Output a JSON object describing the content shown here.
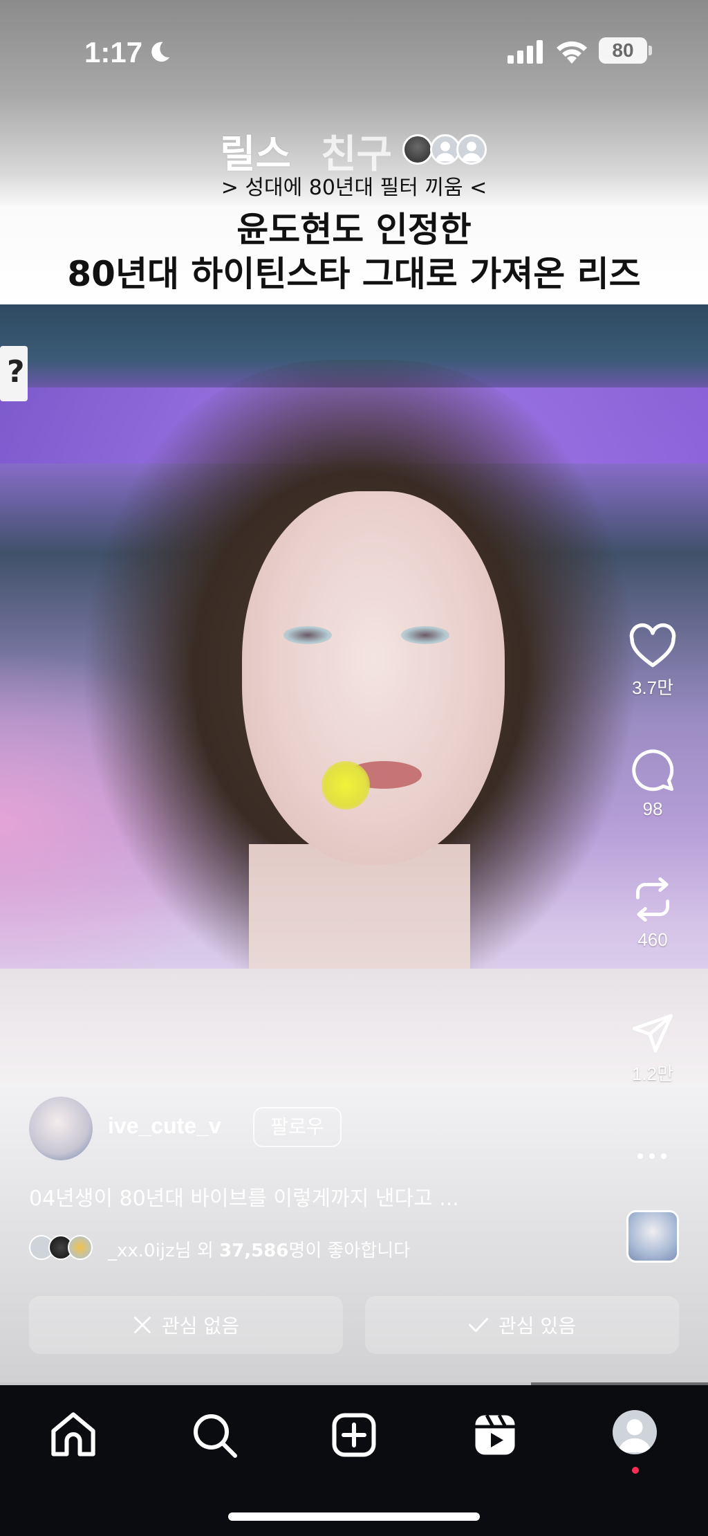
{
  "status_bar": {
    "time": "1:17",
    "battery": "80"
  },
  "header": {
    "tab_reels": "릴스",
    "tab_friends": "친구",
    "video_subtitle_small": "> 성대에 80년대 필터 끼움 <",
    "headline_line1": "윤도현도 인정한",
    "headline_line2": "80년대 하이틴스타 그대로 가져온 리즈"
  },
  "video": {
    "sign_text": "?"
  },
  "actions": {
    "like_count": "3.7만",
    "comment_count": "98",
    "repost_count": "460",
    "share_count": "1.2만"
  },
  "author": {
    "username": "ive_cute_v",
    "follow_label": "팔로우",
    "caption": "04년생이 80년대 바이브를 이렇게까지 낸다고 ..."
  },
  "likes": {
    "user": "_xx.0ijz",
    "middle": "님 외 ",
    "count": "37,586",
    "suffix": "명이 좋아합니다"
  },
  "buttons": {
    "not_interested": "관심 없음",
    "interested": "관심 있음"
  },
  "progress": {
    "fraction": 0.75
  },
  "colors": {
    "notification_dot": "#ff2d55",
    "nav_background": "#0b0c10"
  },
  "icons": [
    "moon-icon",
    "signal-icon",
    "wifi-icon",
    "heart-icon",
    "comment-icon",
    "repost-icon",
    "share-icon",
    "more-icon",
    "close-icon",
    "check-icon",
    "home-icon",
    "search-icon",
    "create-icon",
    "reels-icon"
  ]
}
